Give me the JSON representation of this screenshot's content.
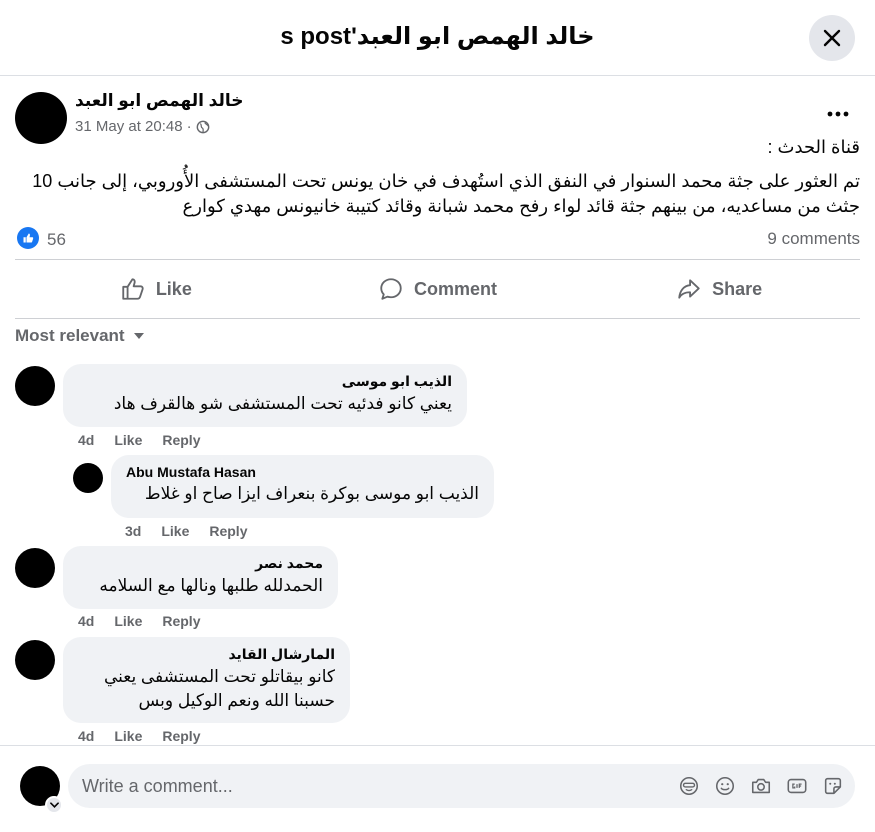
{
  "modal": {
    "title": "خالد الهمص ابو العبد's post"
  },
  "post": {
    "author": "خالد الهمص ابو العبد",
    "timestamp": "31 May at 20:48",
    "separator": "·",
    "source": "قناة الحدث :",
    "body": "تم العثور على جثة محمد السنوار في النفق الذي استُهدف في خان يونس تحت المستشفى الأُوروبي، إلى جانب 10 جثث من مساعديه، من بينهم جثة قائد لواء رفح محمد شبانة وقائد كتيبة خانيونس مهدي كوارع",
    "reaction_count": "56",
    "comment_count": "9 comments",
    "actions": {
      "like": "Like",
      "comment": "Comment",
      "share": "Share"
    }
  },
  "comments_section": {
    "sort_label": "Most relevant",
    "comments": [
      {
        "author": "الذيب ابو موسى",
        "text": "يعني كانو فدئيه تحت المستشفى شو هالقرف هاد",
        "time": "4d",
        "like": "Like",
        "reply": "Reply"
      },
      {
        "author": "Abu Mustafa Hasan",
        "text": "الذيب ابو موسى بوكرة بنعراف ايزا صاح او غلاط",
        "time": "3d",
        "like": "Like",
        "reply": "Reply"
      },
      {
        "author": "محمد نصر",
        "text": "الحمدلله طلبها ونالها مع السلامه",
        "time": "4d",
        "like": "Like",
        "reply": "Reply"
      },
      {
        "author": "المارشال القايد",
        "text": "كانو بيقاتلو تحت المستشفى يعني\nحسبنا الله ونعم الوكيل وبس",
        "time": "4d",
        "like": "Like",
        "reply": "Reply"
      }
    ]
  },
  "composer": {
    "placeholder": "Write a comment..."
  },
  "colors": {
    "accent": "#1877f2",
    "bubble": "#f0f2f5",
    "secondary_text": "#65676b"
  }
}
